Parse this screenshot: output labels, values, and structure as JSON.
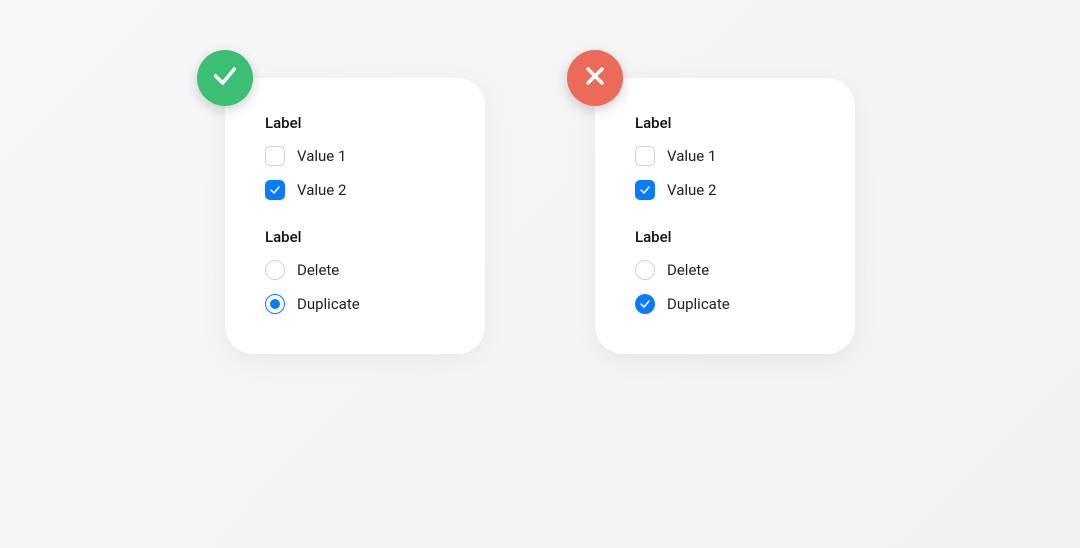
{
  "colors": {
    "accent": "#0a7aff",
    "badge_good": "#3bbf74",
    "badge_bad": "#ec6b58"
  },
  "examples": [
    {
      "kind": "do",
      "badge_icon": "check-icon",
      "groups": [
        {
          "label": "Label",
          "type": "checkbox",
          "options": [
            {
              "label": "Value 1",
              "checked": false
            },
            {
              "label": "Value 2",
              "checked": true
            }
          ]
        },
        {
          "label": "Label",
          "type": "radio",
          "options": [
            {
              "label": "Delete",
              "checked": false
            },
            {
              "label": "Duplicate",
              "checked": true
            }
          ]
        }
      ]
    },
    {
      "kind": "dont",
      "badge_icon": "close-icon",
      "groups": [
        {
          "label": "Label",
          "type": "checkbox",
          "options": [
            {
              "label": "Value 1",
              "checked": false
            },
            {
              "label": "Value 2",
              "checked": true
            }
          ]
        },
        {
          "label": "Label",
          "type": "radio-misrendered-as-checkbox",
          "options": [
            {
              "label": "Delete",
              "checked": false
            },
            {
              "label": "Duplicate",
              "checked": true
            }
          ]
        }
      ]
    }
  ]
}
